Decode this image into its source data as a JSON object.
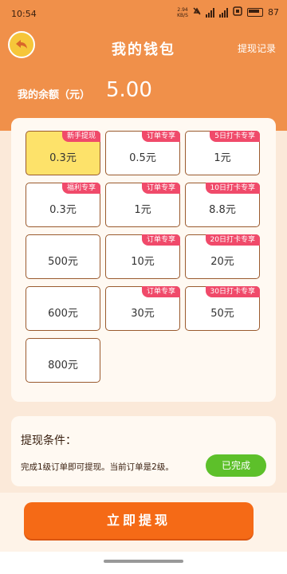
{
  "status": {
    "time": "10:54",
    "speed": "2.94",
    "speed_unit": "KB/S",
    "battery": "87"
  },
  "header": {
    "title": "我的钱包",
    "record": "提现记录",
    "balance_label": "我的余额（元）",
    "balance": "5.00"
  },
  "cards": [
    {
      "amount": "0.3元",
      "tag": "新手提现",
      "selected": true
    },
    {
      "amount": "0.5元",
      "tag": "订单专享"
    },
    {
      "amount": "1元",
      "tag": "5日打卡专享"
    },
    {
      "amount": "0.3元",
      "tag": "福利专享"
    },
    {
      "amount": "1元",
      "tag": "订单专享"
    },
    {
      "amount": "8.8元",
      "tag": "10日打卡专享"
    },
    {
      "amount": "500元",
      "tag": ""
    },
    {
      "amount": "10元",
      "tag": "订单专享"
    },
    {
      "amount": "20元",
      "tag": "20日打卡专享"
    },
    {
      "amount": "600元",
      "tag": ""
    },
    {
      "amount": "30元",
      "tag": "订单专享"
    },
    {
      "amount": "50元",
      "tag": "30日打卡专享"
    },
    {
      "amount": "800元",
      "tag": ""
    }
  ],
  "condition": {
    "title": "提现条件：",
    "text": "完成1级订单即可提现。当前订单是2级。",
    "done_label": "已完成"
  },
  "submit_label": "立即提现",
  "colors": {
    "header": "#F0904A",
    "tag": "#F04A6A",
    "selected": "#FDE26A",
    "done": "#5DC02A",
    "submit": "#F56A16"
  }
}
